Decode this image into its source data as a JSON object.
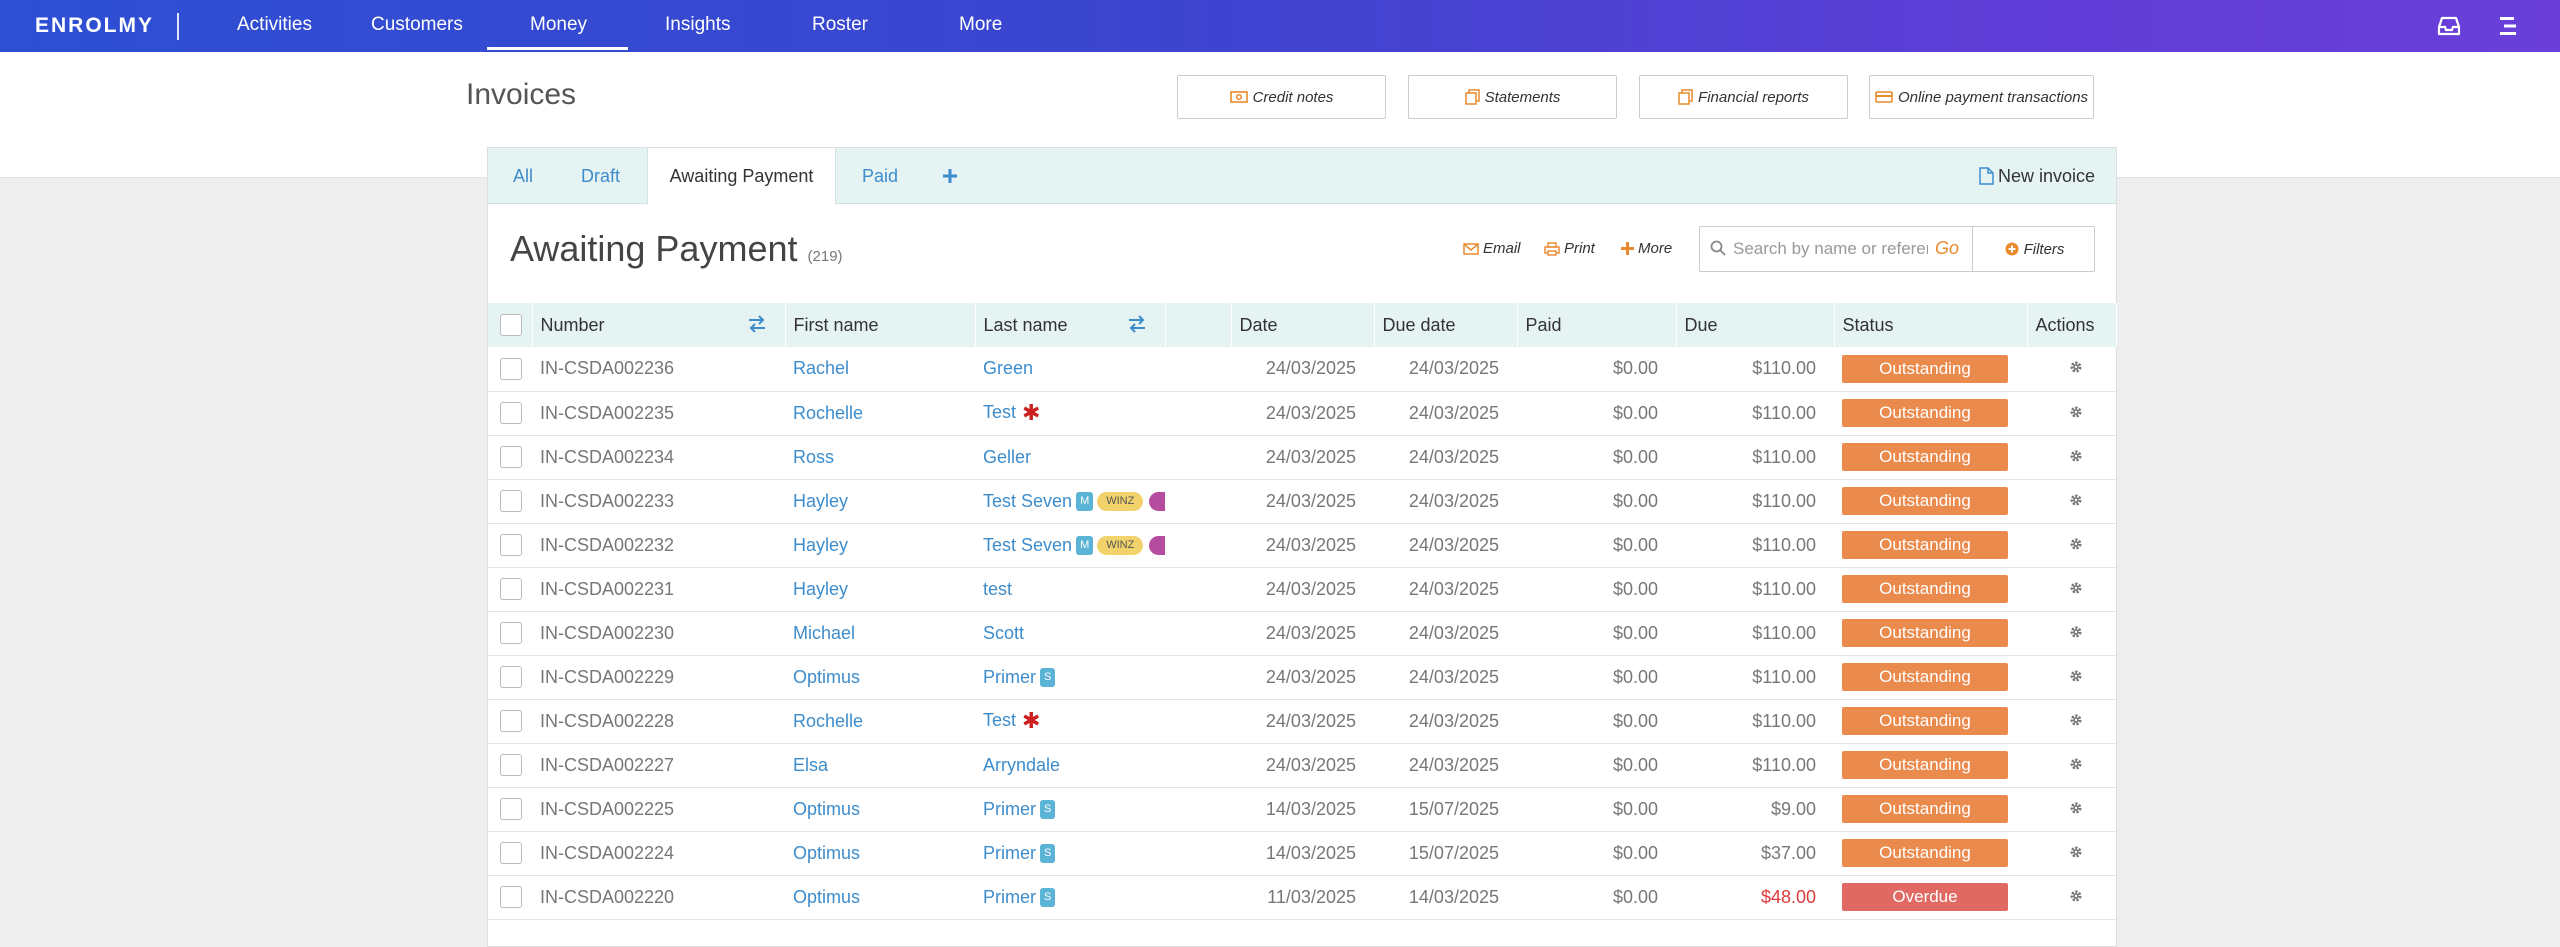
{
  "app": {
    "logo": "ENROLMY"
  },
  "nav": {
    "items": [
      "Activities",
      "Customers",
      "Money",
      "Insights",
      "Roster",
      "More"
    ],
    "active": "Money"
  },
  "header": {
    "title": "Invoices",
    "buttons": [
      "Credit notes",
      "Statements",
      "Financial reports",
      "Online payment transactions"
    ]
  },
  "tabs": {
    "items": [
      "All",
      "Draft",
      "Awaiting Payment",
      "Paid"
    ],
    "active": "Awaiting Payment",
    "new_invoice": "New invoice"
  },
  "section": {
    "title": "Awaiting Payment",
    "count": "(219)"
  },
  "actions": {
    "email": "Email",
    "print": "Print",
    "more": "More"
  },
  "search": {
    "placeholder": "Search by name or reference",
    "go": "Go",
    "filters": "Filters"
  },
  "table": {
    "columns": [
      "Number",
      "First name",
      "Last name",
      "",
      "Date",
      "Due date",
      "Paid",
      "Due",
      "Status",
      "Actions"
    ],
    "rows": [
      {
        "number": "IN-CSDA002236",
        "first": "Rachel",
        "last": "Green",
        "date": "24/03/2025",
        "due_date": "24/03/2025",
        "paid": "$0.00",
        "due": "$110.00",
        "status": "Outstanding"
      },
      {
        "number": "IN-CSDA002235",
        "first": "Rochelle",
        "last": "Test",
        "date": "24/03/2025",
        "due_date": "24/03/2025",
        "paid": "$0.00",
        "due": "$110.00",
        "status": "Outstanding"
      },
      {
        "number": "IN-CSDA002234",
        "first": "Ross",
        "last": "Geller",
        "date": "24/03/2025",
        "due_date": "24/03/2025",
        "paid": "$0.00",
        "due": "$110.00",
        "status": "Outstanding"
      },
      {
        "number": "IN-CSDA002233",
        "first": "Hayley",
        "last": "Test Seven",
        "date": "24/03/2025",
        "due_date": "24/03/2025",
        "paid": "$0.00",
        "due": "$110.00",
        "status": "Outstanding"
      },
      {
        "number": "IN-CSDA002232",
        "first": "Hayley",
        "last": "Test Seven",
        "date": "24/03/2025",
        "due_date": "24/03/2025",
        "paid": "$0.00",
        "due": "$110.00",
        "status": "Outstanding"
      },
      {
        "number": "IN-CSDA002231",
        "first": "Hayley",
        "last": "test",
        "date": "24/03/2025",
        "due_date": "24/03/2025",
        "paid": "$0.00",
        "due": "$110.00",
        "status": "Outstanding"
      },
      {
        "number": "IN-CSDA002230",
        "first": "Michael",
        "last": "Scott",
        "date": "24/03/2025",
        "due_date": "24/03/2025",
        "paid": "$0.00",
        "due": "$110.00",
        "status": "Outstanding"
      },
      {
        "number": "IN-CSDA002229",
        "first": "Optimus",
        "last": "Primer",
        "date": "24/03/2025",
        "due_date": "24/03/2025",
        "paid": "$0.00",
        "due": "$110.00",
        "status": "Outstanding"
      },
      {
        "number": "IN-CSDA002228",
        "first": "Rochelle",
        "last": "Test",
        "date": "24/03/2025",
        "due_date": "24/03/2025",
        "paid": "$0.00",
        "due": "$110.00",
        "status": "Outstanding"
      },
      {
        "number": "IN-CSDA002227",
        "first": "Elsa",
        "last": "Arryndale",
        "date": "24/03/2025",
        "due_date": "24/03/2025",
        "paid": "$0.00",
        "due": "$110.00",
        "status": "Outstanding"
      },
      {
        "number": "IN-CSDA002225",
        "first": "Optimus",
        "last": "Primer",
        "date": "14/03/2025",
        "due_date": "15/07/2025",
        "paid": "$0.00",
        "due": "$9.00",
        "status": "Outstanding"
      },
      {
        "number": "IN-CSDA002224",
        "first": "Optimus",
        "last": "Primer",
        "date": "14/03/2025",
        "due_date": "15/07/2025",
        "paid": "$0.00",
        "due": "$37.00",
        "status": "Outstanding"
      },
      {
        "number": "IN-CSDA002220",
        "first": "Optimus",
        "last": "Primer",
        "date": "11/03/2025",
        "due_date": "14/03/2025",
        "paid": "$0.00",
        "due": "$48.00",
        "status": "Overdue"
      }
    ],
    "tags": {
      "m": "M",
      "winz": "WINZ",
      "s": "S"
    }
  },
  "colors": {
    "accent": "#3d8ccc",
    "outstanding": "#ea8a4d",
    "overdue": "#e06a63",
    "nav_start": "#2d4fd3",
    "nav_end": "#6a3fd9",
    "go": "#e98a2c"
  }
}
